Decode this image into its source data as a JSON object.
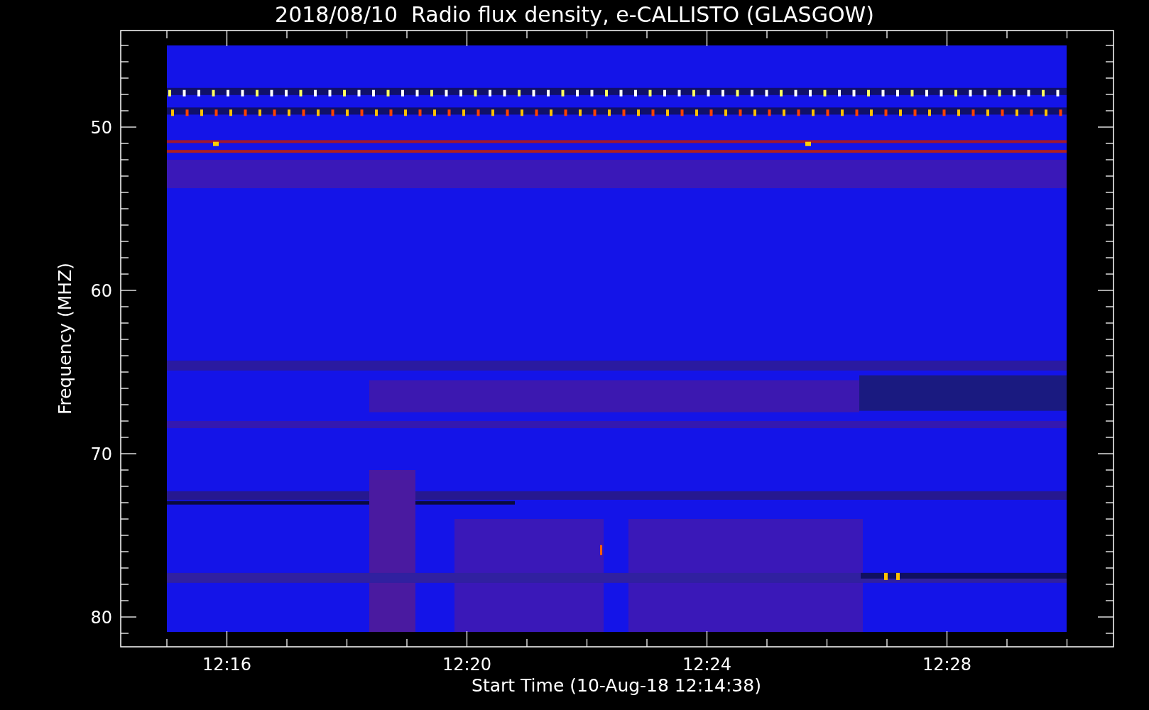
{
  "title": "2018/08/10  Radio flux density, e-CALLISTO (GLASGOW)",
  "y_axis": {
    "label": "Frequency (MHZ)",
    "tick_labels": [
      "50",
      "60",
      "70",
      "80"
    ]
  },
  "x_axis": {
    "label": "Start Time (10-Aug-18 12:14:38)",
    "tick_labels": [
      "12:16",
      "12:20",
      "12:24",
      "12:28"
    ]
  }
}
